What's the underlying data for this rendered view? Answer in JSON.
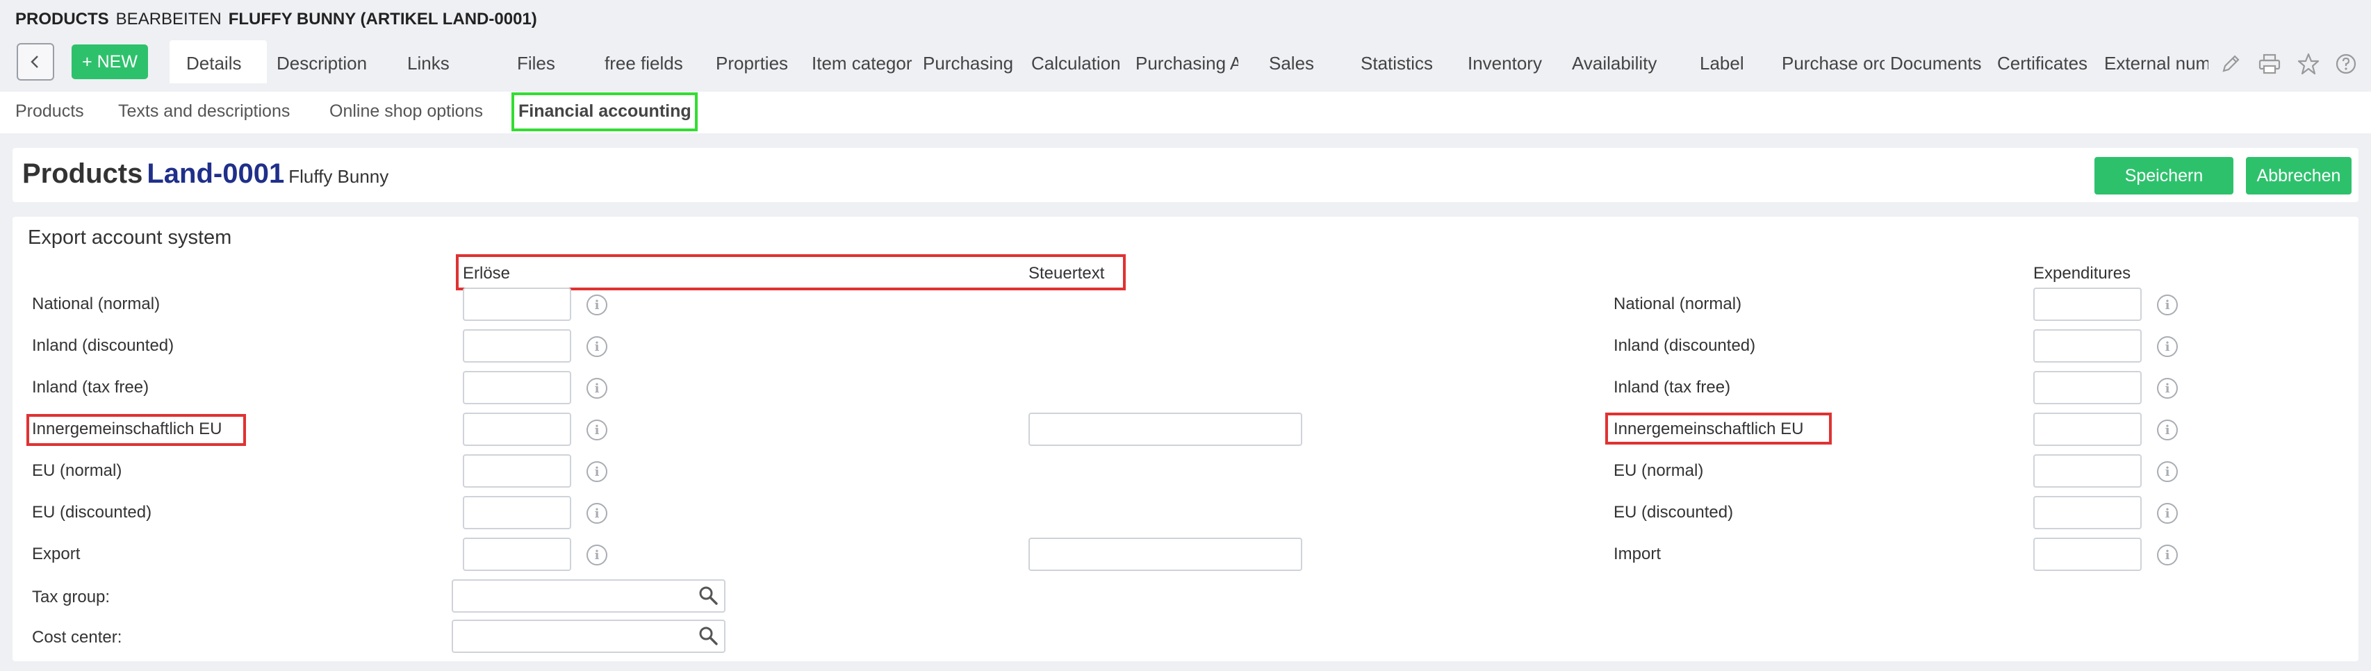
{
  "breadcrumb": {
    "section": "PRODUCTS",
    "action": "BEARBEITEN",
    "item": "FLUFFY BUNNY (ARTIKEL LAND-0001)"
  },
  "toolbar": {
    "new_label": "+ NEW",
    "tabs": [
      "Details",
      "Description",
      "Links",
      "Files",
      "free fields",
      "Proprties",
      "Item categor",
      "Purchasing",
      "Calculation",
      "Purchasing A",
      "Sales",
      "Statistics",
      "Inventory",
      "Availability",
      "Label",
      "Purchase orc",
      "Documents",
      "Certificates",
      "External num"
    ],
    "active_tab": "Details"
  },
  "subtabs": [
    "Products",
    "Texts and descriptions",
    "Online shop options",
    "Financial accounting"
  ],
  "active_subtab": "Financial accounting",
  "header": {
    "title": "Products",
    "number": "Land-0001",
    "name": "Fluffy Bunny",
    "save_label": "Speichern",
    "cancel_label": "Abbrechen"
  },
  "section": {
    "title": "Export account system",
    "col_revenue": "Erlöse",
    "col_taxtext": "Steuertext",
    "col_expenditures": "Expenditures",
    "left_rows": [
      "National (normal)",
      "Inland (discounted)",
      "Inland (tax free)",
      "Innergemeinschaftlich EU",
      "EU (normal)",
      "EU (discounted)",
      "Export"
    ],
    "right_rows": [
      "National (normal)",
      "Inland (discounted)",
      "Inland (tax free)",
      "Innergemeinschaftlich EU",
      "EU (normal)",
      "EU (discounted)",
      "Import"
    ],
    "tax_group_label": "Tax group:",
    "cost_center_label": "Cost center:"
  },
  "colors": {
    "accent_green": "#2ec16c",
    "title_blue": "#1f2f8a",
    "highlight_red": "#e03232",
    "highlight_green": "#33dd33"
  }
}
